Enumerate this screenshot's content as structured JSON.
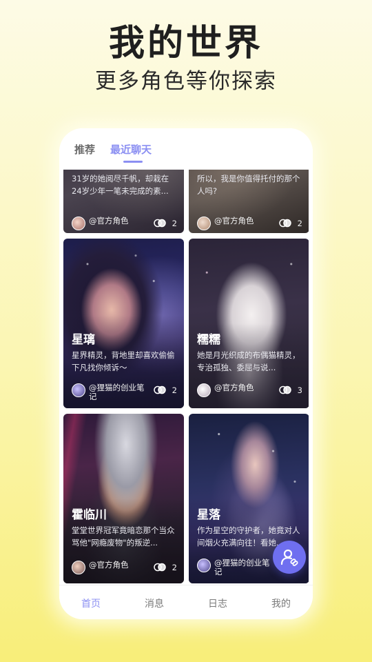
{
  "headline": "我的世界",
  "subhead": "更多角色等你探索",
  "tabs": [
    {
      "label": "推荐",
      "active": false
    },
    {
      "label": "最近聊天",
      "active": true
    }
  ],
  "cards": [
    {
      "name": "",
      "desc": "31岁的她阅尽千帆，却栽在24岁少年一笔未完成的素...",
      "author": "@官方角色",
      "views": "2"
    },
    {
      "name": "",
      "desc": "所以，我是你值得托付的那个人吗?",
      "author": "@官方角色",
      "views": "2"
    },
    {
      "name": "星璃",
      "desc": "星界精灵，背地里却喜欢偷偷下凡找你倾诉～",
      "author": "@狸猫的创业笔记",
      "views": "2"
    },
    {
      "name": "糯糯",
      "desc": "她是月光织成的布偶猫精灵，专治孤独、委屈与说...",
      "author": "@官方角色",
      "views": "3"
    },
    {
      "name": "霍临川",
      "desc": "堂堂世界冠军竟暗恋那个当众骂他\"网瘾废物\"的叛逆...",
      "author": "@官方角色",
      "views": "2"
    },
    {
      "name": "星落",
      "desc": "作为星空的守护者，她竟对人间烟火充满向往！看她...",
      "author": "@狸猫的创业笔记",
      "views": ""
    }
  ],
  "nav": [
    {
      "label": "首页",
      "active": true
    },
    {
      "label": "消息",
      "active": false
    },
    {
      "label": "日志",
      "active": false
    },
    {
      "label": "我的",
      "active": false
    }
  ],
  "icons": {
    "fab": "user-link-icon",
    "views": "toggle-icon"
  },
  "colors": {
    "accent": "#8b8ff2",
    "fab": "#6f6ff0"
  }
}
